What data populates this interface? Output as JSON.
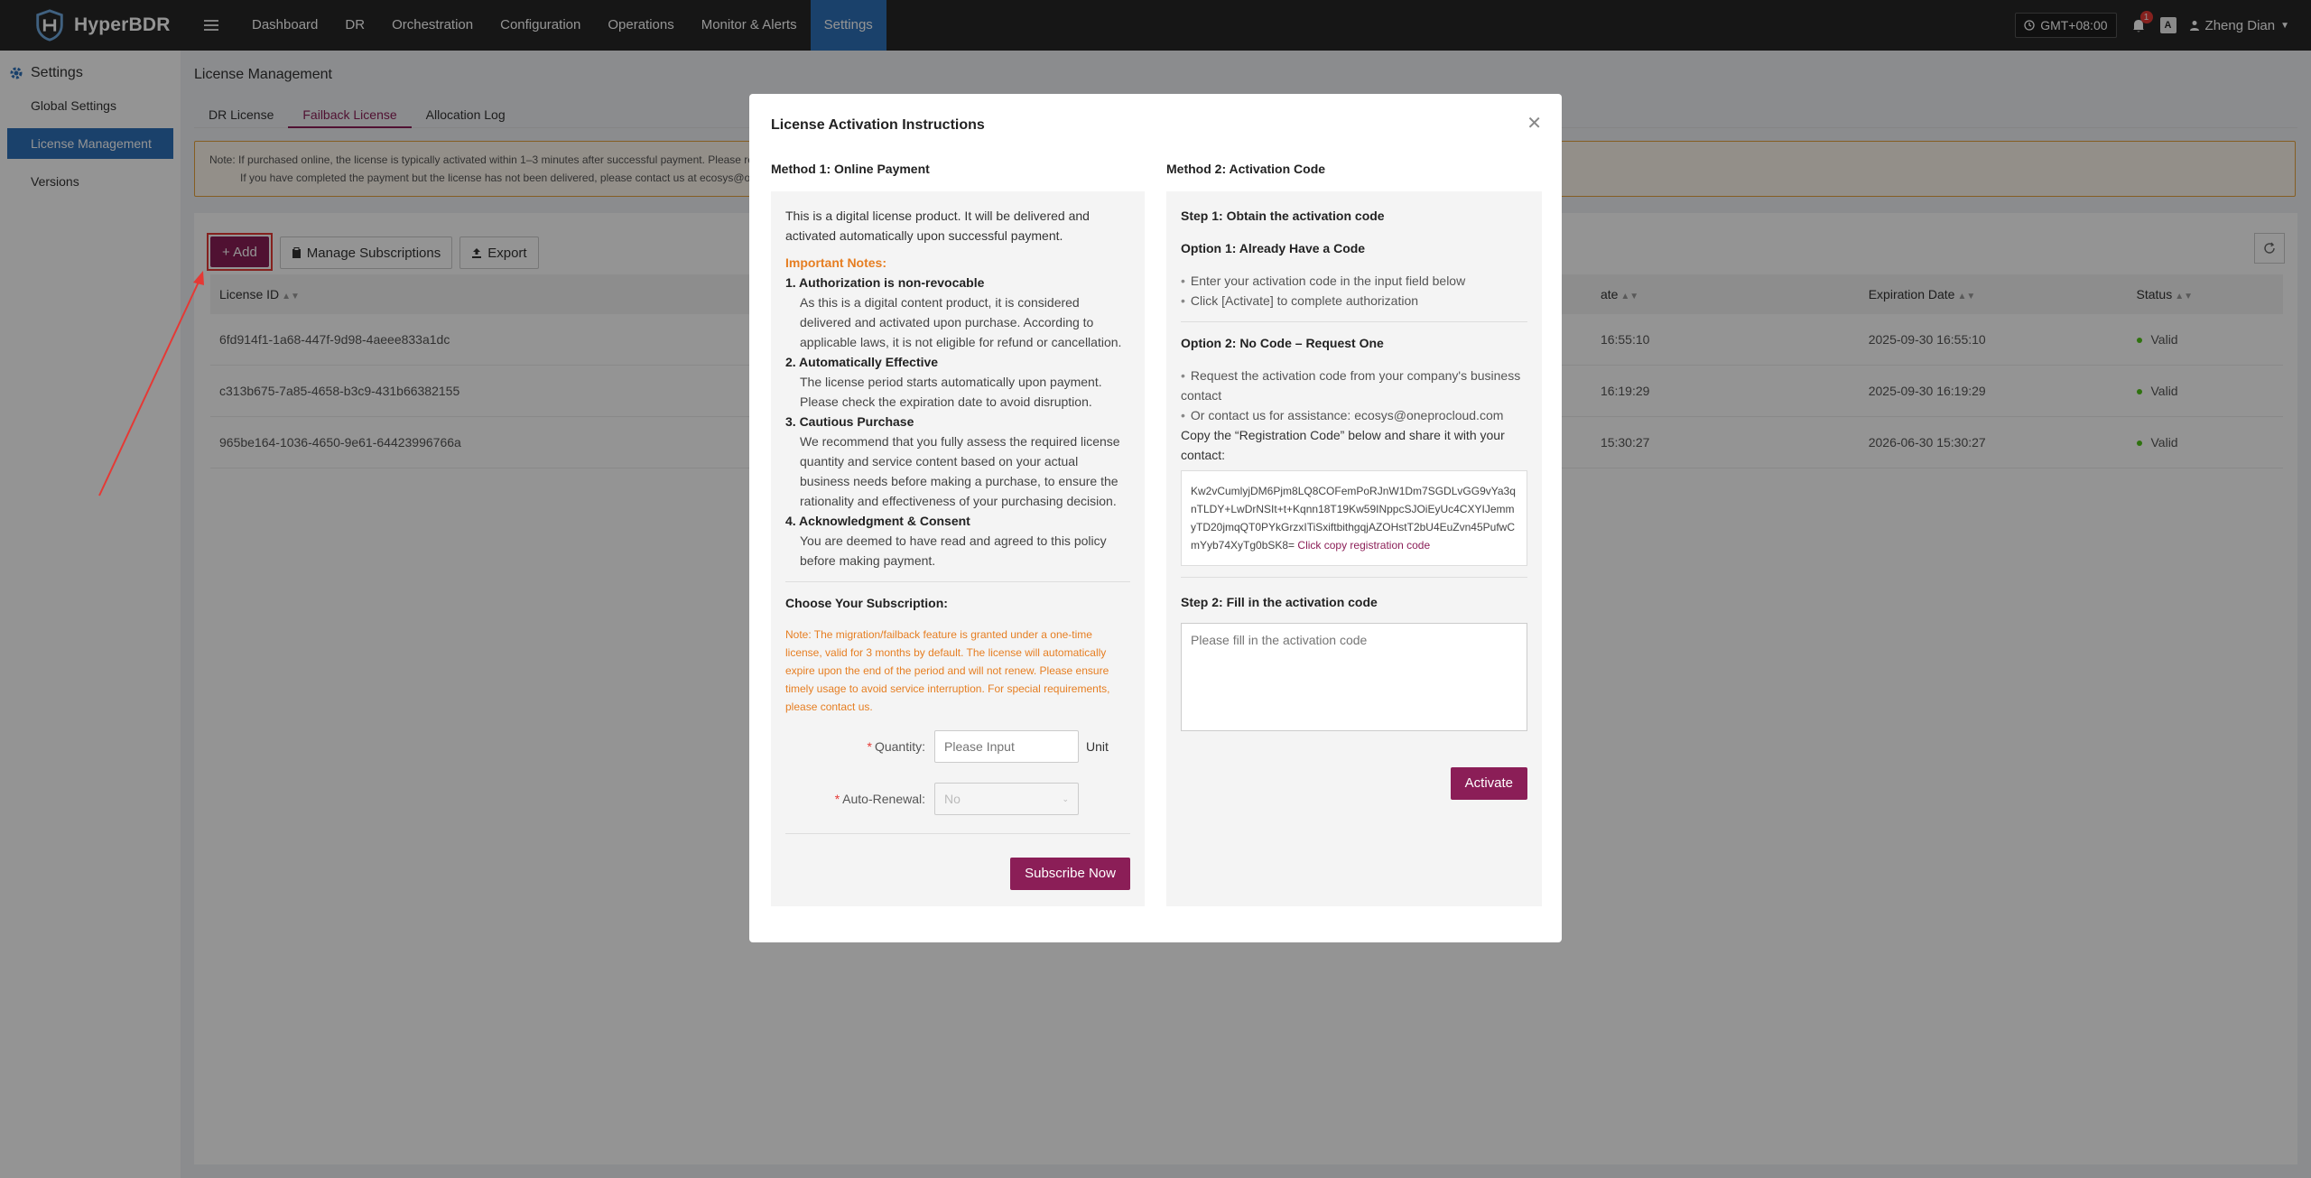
{
  "app": {
    "name": "HyperBDR"
  },
  "nav": [
    {
      "label": "Dashboard",
      "active": false
    },
    {
      "label": "DR",
      "active": false
    },
    {
      "label": "Orchestration",
      "active": false
    },
    {
      "label": "Configuration",
      "active": false
    },
    {
      "label": "Operations",
      "active": false
    },
    {
      "label": "Monitor & Alerts",
      "active": false
    },
    {
      "label": "Settings",
      "active": true
    }
  ],
  "topbar": {
    "timezone": "GMT+08:00",
    "notification_count": "1",
    "lang_label": "A",
    "user": "Zheng Dian"
  },
  "sidebar": {
    "title": "Settings",
    "items": [
      {
        "label": "Global Settings",
        "active": false
      },
      {
        "label": "License Management",
        "active": true
      },
      {
        "label": "Versions",
        "active": false
      }
    ]
  },
  "page": {
    "title": "License Management",
    "tabs": [
      {
        "label": "DR License",
        "active": false
      },
      {
        "label": "Failback License",
        "active": true
      },
      {
        "label": "Allocation Log",
        "active": false
      }
    ],
    "note_line1": "Note: If purchased online, the license is typically activated within 1–3 minutes after successful payment. Please ref",
    "note_line2": "If you have completed the payment but the license has not been delivered, please contact us at ecosys@on"
  },
  "toolbar": {
    "add": "+ Add",
    "manage": "Manage Subscriptions",
    "export": "Export"
  },
  "table": {
    "headers": [
      "License ID",
      "ate",
      "Expiration Date",
      "Status"
    ],
    "rows": [
      {
        "id": "6fd914f1-1a68-447f-9d98-4aeee833a1dc",
        "start": "16:55:10",
        "expiration": "2025-09-30 16:55:10",
        "status": "Valid"
      },
      {
        "id": "c313b675-7a85-4658-b3c9-431b66382155",
        "start": "16:19:29",
        "expiration": "2025-09-30 16:19:29",
        "status": "Valid"
      },
      {
        "id": "965be164-1036-4650-9e61-64423996766a",
        "start": "15:30:27",
        "expiration": "2026-06-30 15:30:27",
        "status": "Valid"
      }
    ]
  },
  "modal": {
    "title": "License Activation Instructions",
    "method1": {
      "heading": "Method 1: Online Payment",
      "intro": "This is a digital license product. It will be delivered and activated automatically upon successful payment.",
      "notes_title": "Important Notes:",
      "notes": [
        {
          "title": "1. Authorization is non-revocable",
          "body": "As this is a digital content product, it is considered delivered and activated upon purchase. According to applicable laws, it is not eligible for refund or cancellation."
        },
        {
          "title": "2. Automatically Effective",
          "body": "The license period starts automatically upon payment. Please check the expiration date to avoid disruption."
        },
        {
          "title": "3. Cautious Purchase",
          "body": "We recommend that you fully assess the required license quantity and service content based on your actual business needs before making a purchase, to ensure the rationality and effectiveness of your purchasing decision."
        },
        {
          "title": "4. Acknowledgment & Consent",
          "body": "You are deemed to have read and agreed to this policy before making payment."
        }
      ],
      "choose_title": "Choose Your Subscription:",
      "sub_note": "Note: The migration/failback feature is granted under a one-time license, valid for 3 months by default. The license will automatically expire upon the end of the period and will not renew. Please ensure timely usage to avoid service interruption. For special requirements, please contact us.",
      "quantity_label": "Quantity:",
      "quantity_placeholder": "Please Input",
      "unit": "Unit",
      "renewal_label": "Auto-Renewal:",
      "renewal_value": "No",
      "subscribe_btn": "Subscribe Now"
    },
    "method2": {
      "heading": "Method 2: Activation Code",
      "step1": "Step 1: Obtain the activation code",
      "opt1_title": "Option 1: Already Have a Code",
      "opt1_items": [
        "Enter your activation code in the input field below",
        "Click [Activate] to complete authorization"
      ],
      "opt2_title": "Option 2: No Code – Request One",
      "opt2_items": [
        "Request the activation code from your company's business contact",
        "Or contact us for assistance: ecosys@oneprocloud.com"
      ],
      "copy_text": "Copy the “Registration Code” below and share it with your contact:",
      "reg_code": "Kw2vCumlyjDM6Pjm8LQ8COFemPoRJnW1Dm7SGDLvGG9vYa3qnTLDY+LwDrNSIt+t+Kqnn18T19Kw59INppcSJOiEyUc4CXYIJemmyTD20jmqQT0PYkGrzxITiSxiftbithgqjAZOHstT2bU4EuZvn45PufwCmYyb74XyTg0bSK8=",
      "reg_link": "Click copy registration code",
      "step2": "Step 2: Fill in the activation code",
      "activation_placeholder": "Please fill in the activation code",
      "activate_btn": "Activate"
    }
  },
  "colors": {
    "brand": "#8b1e57",
    "nav_active": "#2e70b8",
    "topbar": "#262626",
    "warning": "#e6a23c",
    "valid": "#52c41a"
  }
}
